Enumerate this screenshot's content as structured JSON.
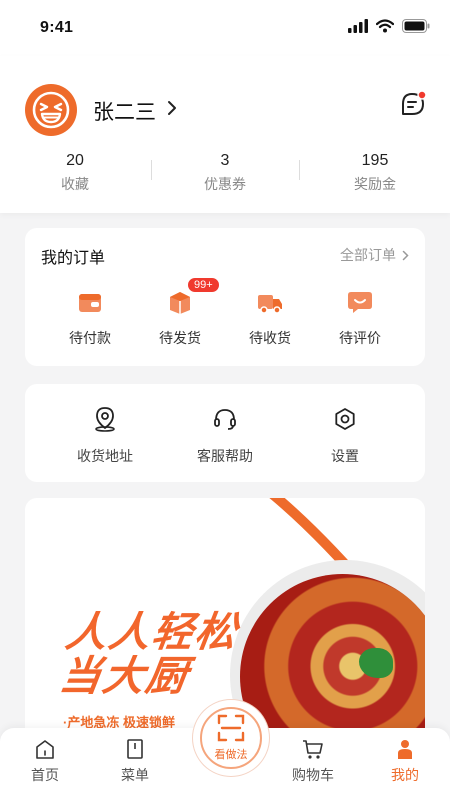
{
  "status_bar": {
    "time": "9:41"
  },
  "profile": {
    "name": "张二三",
    "stats": [
      {
        "value": "20",
        "label": "收藏"
      },
      {
        "value": "3",
        "label": "优惠券"
      },
      {
        "value": "195",
        "label": "奖励金"
      }
    ]
  },
  "orders": {
    "title": "我的订单",
    "all_label": "全部订单",
    "items": [
      {
        "label": "待付款",
        "icon": "wallet-icon"
      },
      {
        "label": "待发货",
        "icon": "package-icon",
        "badge": "99+"
      },
      {
        "label": "待收货",
        "icon": "truck-icon"
      },
      {
        "label": "待评价",
        "icon": "review-icon"
      }
    ]
  },
  "services": {
    "items": [
      {
        "label": "收货地址",
        "icon": "location-pin-icon"
      },
      {
        "label": "客服帮助",
        "icon": "headset-icon"
      },
      {
        "label": "设置",
        "icon": "gear-icon"
      }
    ]
  },
  "banner": {
    "title_line1": "人人轻松",
    "title_line2": "当大厨",
    "subtitle": "·产地急冻 极速锁鲜"
  },
  "tab_bar": {
    "tabs": [
      {
        "label": "首页",
        "icon": "home-icon"
      },
      {
        "label": "菜单",
        "icon": "menu-book-icon"
      },
      {
        "label": "购物车",
        "icon": "cart-icon"
      },
      {
        "label": "我的",
        "icon": "user-icon",
        "active": true
      }
    ],
    "scan_label": "看做法"
  },
  "colors": {
    "accent": "#ee6b2b",
    "badge": "#f03a2e",
    "background": "#f4f4f5"
  }
}
